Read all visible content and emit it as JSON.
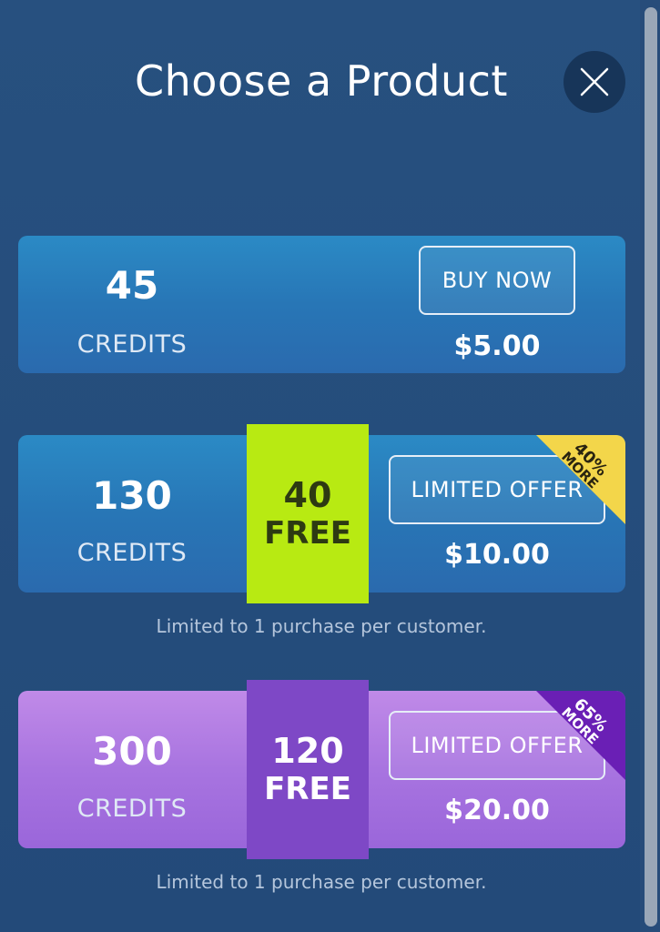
{
  "dialog": {
    "title": "Choose a Product",
    "close_icon": "close-icon"
  },
  "products": [
    {
      "amount": "45",
      "unit": "CREDITS",
      "button_label": "BUY NOW",
      "price": "$5.00"
    },
    {
      "amount": "130",
      "unit": "CREDITS",
      "bonus_amount": "40",
      "bonus_label": "FREE",
      "button_label": "LIMITED OFFER",
      "price": "$10.00",
      "badge_percent": "40%",
      "badge_label": "MORE",
      "note": "Limited to 1 purchase per customer."
    },
    {
      "amount": "300",
      "unit": "CREDITS",
      "bonus_amount": "120",
      "bonus_label": "FREE",
      "button_label": "LIMITED OFFER",
      "price": "$20.00",
      "badge_percent": "65%",
      "badge_label": "MORE",
      "note": "Limited to 1 purchase per customer."
    }
  ],
  "colors": {
    "background": "#244a7c",
    "card_blue": "#2876b6",
    "card_purple": "#a874e0",
    "bonus_green": "#b8ea12",
    "bonus_violet": "#7e48c6",
    "badge_gold": "#f3d64a",
    "badge_purple": "#6a1fb5"
  }
}
